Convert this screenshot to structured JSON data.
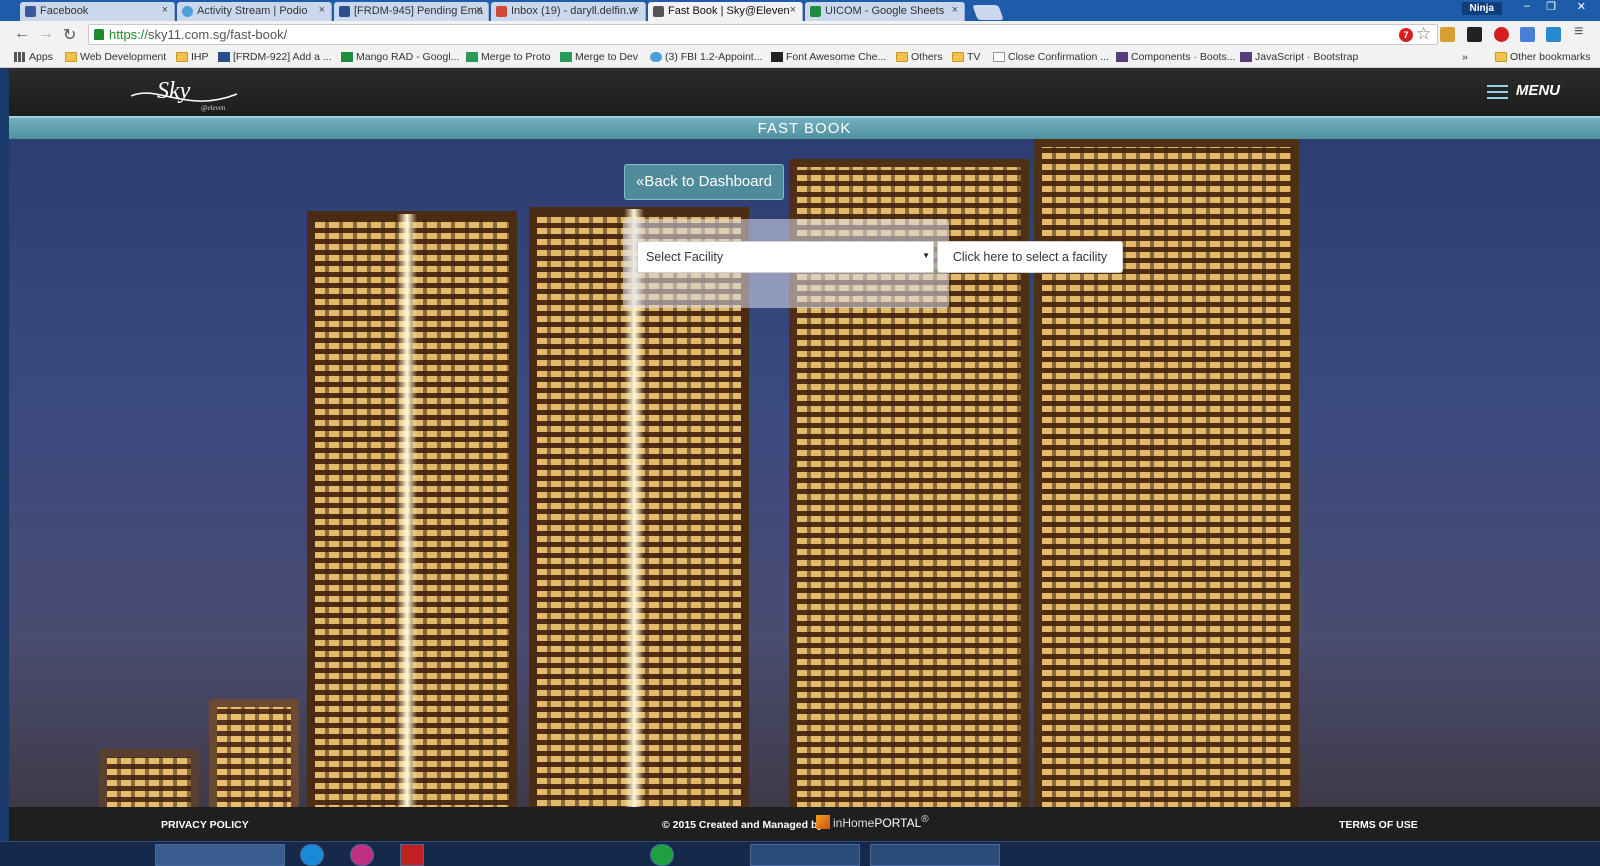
{
  "browser": {
    "tabs": [
      {
        "label": "Facebook",
        "color": "#3b5998",
        "active": false
      },
      {
        "label": "Activity Stream | Podio",
        "color": "#4aa0d8",
        "active": false
      },
      {
        "label": "[FRDM-945] Pending Ema",
        "color": "#2a4f8a",
        "active": false
      },
      {
        "label": "Inbox (19) - daryll.delfin.w",
        "color": "#d14836",
        "active": false
      },
      {
        "label": "Fast Book | Sky@Eleven",
        "color": "#555555",
        "active": true
      },
      {
        "label": "UICOM - Google Sheets",
        "color": "#1e8e3e",
        "active": false
      }
    ],
    "close_glyph": "×",
    "profile_label": "Ninja",
    "url_scheme": "https://",
    "url_rest": "sky11.com.sg/fast-book/",
    "notification_count": "7",
    "bookmarks": [
      "Apps",
      "Web Development",
      "IHP",
      "[FRDM-922] Add a ...",
      "Mango RAD - Googl...",
      "Merge to Proto",
      "Merge to Dev",
      "(3) FBI 1.2-Appoint...",
      "Font Awesome Che...",
      "Others",
      "TV",
      "Close Confirmation ...",
      "Components · Boots...",
      "JavaScript · Bootstrap"
    ],
    "more_bookmarks": "»",
    "other_bookmarks": "Other bookmarks"
  },
  "site": {
    "logo_text": "Sky",
    "logo_sub": "@eleven",
    "menu_label": "MENU",
    "page_title": "FAST BOOK",
    "back_button": "Back to Dashboard",
    "back_icon": "«",
    "facility_select": {
      "selected": "Select Facility",
      "arrow": "▼"
    },
    "select_facility_button": "Click here to select a facility",
    "footer": {
      "privacy": "PRIVACY POLICY",
      "credit": "© 2015 Created and Managed by",
      "brand_in": "inHome",
      "brand_portal": "PORTAL",
      "brand_mark": "®",
      "terms": "TERMS OF USE"
    },
    "colors": {
      "accent": "#4f8b9a",
      "title_bar": "#5a9aab",
      "header": "#262626"
    }
  }
}
